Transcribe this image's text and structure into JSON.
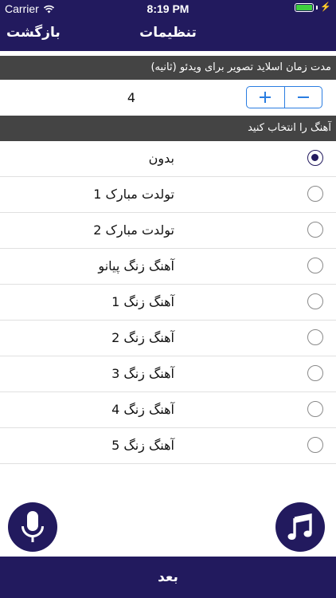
{
  "status_bar": {
    "carrier": "Carrier",
    "time": "8:19 PM"
  },
  "navbar": {
    "title": "تنظیمات",
    "back_label": "بازگشت"
  },
  "slide_duration": {
    "header": "مدت زمان اسلاید تصویر برای ویدئو (ثانیه)",
    "value": "4"
  },
  "music": {
    "header": "آهنگ را انتخاب کنید",
    "options": [
      {
        "label": "بدون",
        "selected": true
      },
      {
        "label": "تولدت مبارک 1",
        "selected": false
      },
      {
        "label": "تولدت مبارک 2",
        "selected": false
      },
      {
        "label": "آهنگ زنگ پیانو",
        "selected": false
      },
      {
        "label": "آهنگ زنگ 1",
        "selected": false
      },
      {
        "label": "آهنگ زنگ 2",
        "selected": false
      },
      {
        "label": "آهنگ زنگ 3",
        "selected": false
      },
      {
        "label": "آهنگ زنگ 4",
        "selected": false
      },
      {
        "label": "آهنگ زنگ 5",
        "selected": false
      }
    ]
  },
  "bottom_bar": {
    "next_label": "بعد"
  },
  "icons": {
    "mic": "microphone-icon",
    "music": "music-note-icon"
  },
  "colors": {
    "primary": "#221a5e",
    "accent": "#2a7de1",
    "header_gray": "#444444"
  }
}
